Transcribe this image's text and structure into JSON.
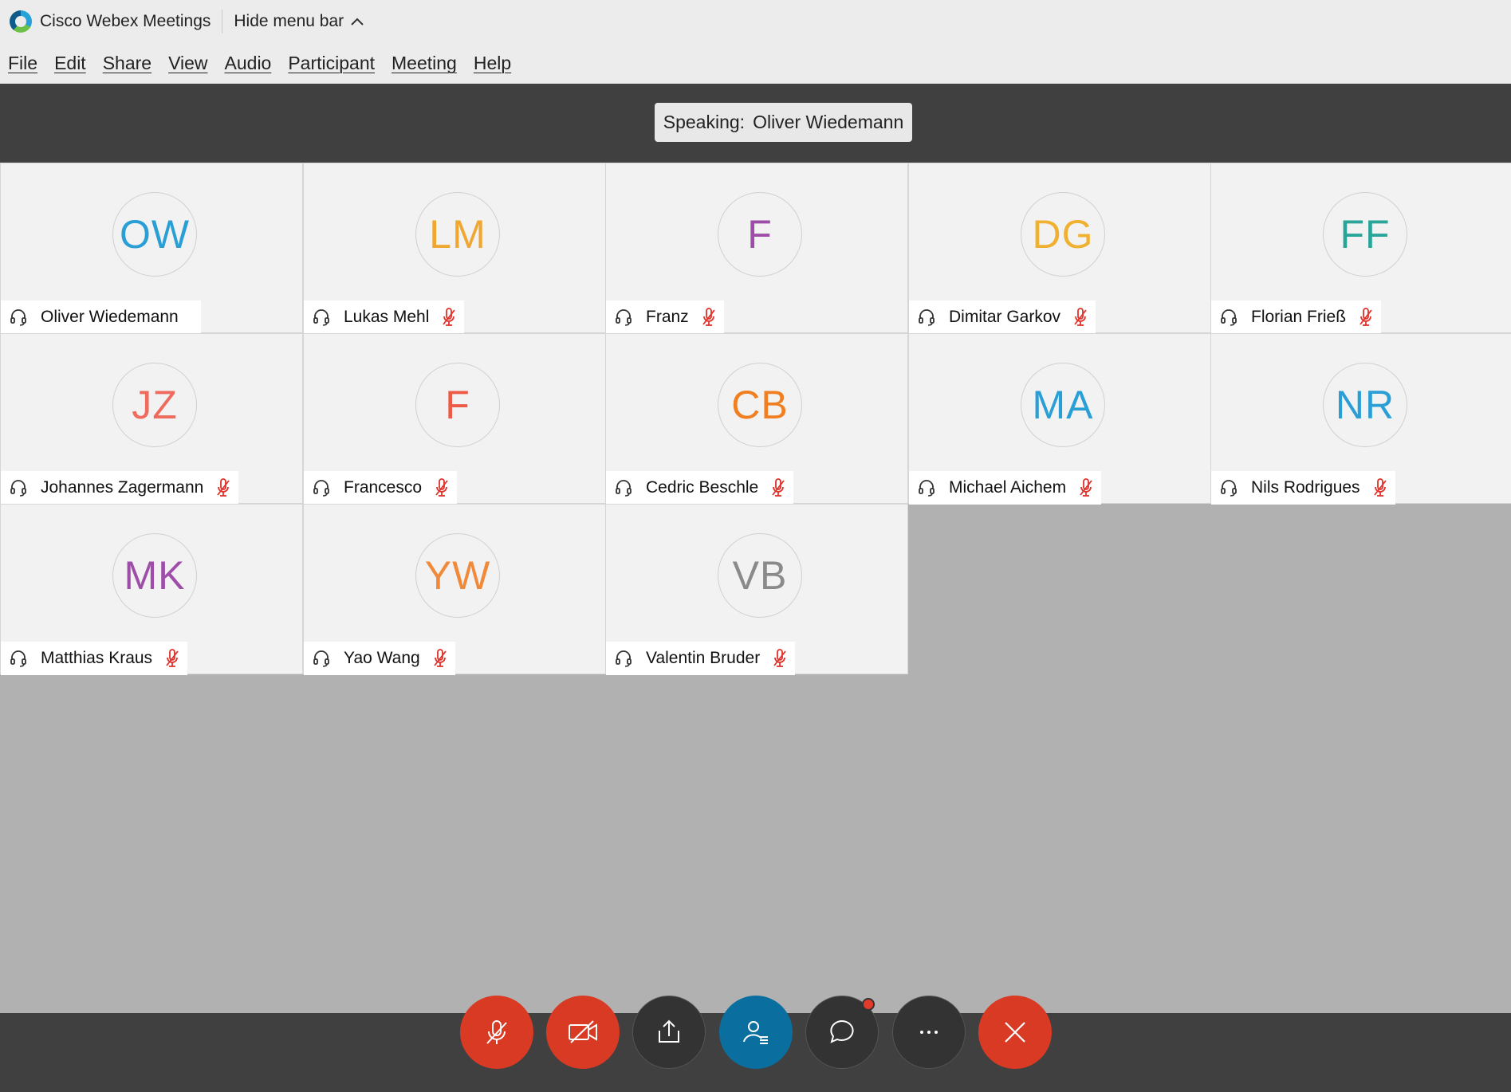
{
  "window": {
    "app_title": "Cisco Webex Meetings",
    "hide_menu_label": "Hide menu bar"
  },
  "menu": [
    "File",
    "Edit",
    "Share",
    "View",
    "Audio",
    "Participant",
    "Meeting",
    "Help"
  ],
  "speaking": {
    "label": "Speaking:",
    "name": "Oliver Wiedemann"
  },
  "participants": [
    {
      "initials": "OW",
      "name": "Oliver Wiedemann",
      "color": "#2a9fd6",
      "muted": false
    },
    {
      "initials": "LM",
      "name": "Lukas Mehl",
      "color": "#f0a732",
      "muted": true
    },
    {
      "initials": "F",
      "name": "Franz",
      "color": "#9e4ea8",
      "muted": true
    },
    {
      "initials": "DG",
      "name": "Dimitar Garkov",
      "color": "#f0b132",
      "muted": true
    },
    {
      "initials": "FF",
      "name": "Florian Frieß",
      "color": "#2aa59a",
      "muted": true
    },
    {
      "initials": "JZ",
      "name": "Johannes Zagermann",
      "color": "#ee6b5e",
      "muted": true
    },
    {
      "initials": "F",
      "name": "Francesco",
      "color": "#ee5a48",
      "muted": true
    },
    {
      "initials": "CB",
      "name": "Cedric Beschle",
      "color": "#f07f22",
      "muted": true
    },
    {
      "initials": "MA",
      "name": "Michael Aichem",
      "color": "#2a9fd6",
      "muted": true
    },
    {
      "initials": "NR",
      "name": "Nils Rodrigues",
      "color": "#2a9fd6",
      "muted": true
    },
    {
      "initials": "MK",
      "name": "Matthias Kraus",
      "color": "#9e4ea8",
      "muted": true
    },
    {
      "initials": "YW",
      "name": "Yao Wang",
      "color": "#f08a3a",
      "muted": true
    },
    {
      "initials": "VB",
      "name": "Valentin Bruder",
      "color": "#8a8a8a",
      "muted": true
    }
  ],
  "controls": [
    {
      "name": "unmute-button",
      "icon": "mic-muted-icon",
      "color": "#d93a24"
    },
    {
      "name": "start-video-button",
      "icon": "video-off-icon",
      "color": "#d93a24"
    },
    {
      "name": "share-button",
      "icon": "share-icon",
      "color": "#333333"
    },
    {
      "name": "participants-button",
      "icon": "participants-icon",
      "color": "#0a6f9f"
    },
    {
      "name": "chat-button",
      "icon": "chat-icon",
      "color": "#333333",
      "notification": true
    },
    {
      "name": "more-button",
      "icon": "more-icon",
      "color": "#333333"
    },
    {
      "name": "leave-meeting-button",
      "icon": "close-icon",
      "color": "#d93a24"
    }
  ]
}
